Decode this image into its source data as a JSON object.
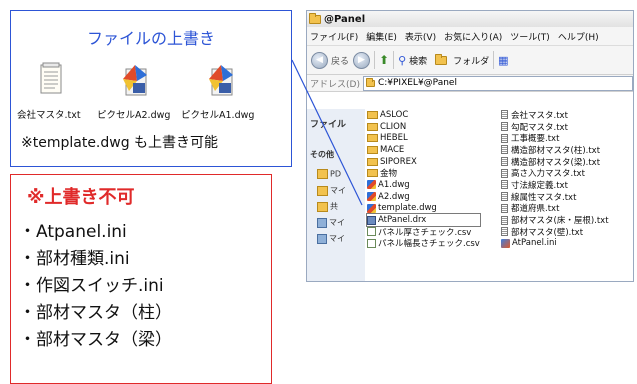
{
  "callout": {
    "title": "ファイルの上書き",
    "files": [
      {
        "label": "会社マスタ.txt",
        "icon": "text-file-icon"
      },
      {
        "label": "ピクセルA2.dwg",
        "icon": "dwg-file-icon"
      },
      {
        "label": "ピクセルA1.dwg",
        "icon": "dwg-file-icon"
      }
    ],
    "note": "※template.dwg も上書き可能"
  },
  "warning": {
    "title": "※上書き不可",
    "items": [
      "・Atpanel.ini",
      "・部材種類.ini",
      "・作図スイッチ.ini",
      "・部材マスタ（柱）",
      "・部材マスタ（梁）"
    ]
  },
  "explorer": {
    "title": "@Panel",
    "menu": [
      "ファイル(F)",
      "編集(E)",
      "表示(V)",
      "お気に入り(A)",
      "ツール(T)",
      "ヘルプ(H)"
    ],
    "toolbar": {
      "back": "戻る",
      "search": "検索",
      "folders": "フォルダ"
    },
    "address_label": "アドレス(D)",
    "address": "C:¥PIXEL¥@Panel",
    "left_pane": {
      "tab1": "ファイル",
      "tab2": "その他",
      "items": [
        "PD",
        "マイ",
        "共",
        "マイ",
        "マイ"
      ]
    },
    "column_a": [
      {
        "name": "ASLOC",
        "type": "folder"
      },
      {
        "name": "CLION",
        "type": "folder"
      },
      {
        "name": "HEBEL",
        "type": "folder"
      },
      {
        "name": "MACE",
        "type": "folder"
      },
      {
        "name": "SIPOREX",
        "type": "folder"
      },
      {
        "name": "金物",
        "type": "folder"
      },
      {
        "name": "A1.dwg",
        "type": "dwg"
      },
      {
        "name": "A2.dwg",
        "type": "dwg"
      },
      {
        "name": "template.dwg",
        "type": "dwg"
      },
      {
        "name": "AtPanel.drx",
        "type": "drx"
      },
      {
        "name": "パネル厚さチェック.csv",
        "type": "csv"
      },
      {
        "name": "パネル幅長さチェック.csv",
        "type": "csv"
      }
    ],
    "column_b": [
      {
        "name": "会社マスタ.txt",
        "type": "txt"
      },
      {
        "name": "勾配マスタ.txt",
        "type": "txt"
      },
      {
        "name": "工事概要.txt",
        "type": "txt"
      },
      {
        "name": "構造部材マスタ(柱).txt",
        "type": "txt"
      },
      {
        "name": "構造部材マスタ(梁).txt",
        "type": "txt"
      },
      {
        "name": "高さ入力マスタ.txt",
        "type": "txt"
      },
      {
        "name": "寸法線定義.txt",
        "type": "txt"
      },
      {
        "name": "線属性マスタ.txt",
        "type": "txt"
      },
      {
        "name": "都道府県.txt",
        "type": "txt"
      },
      {
        "name": "部材マスタ(床・屋根).txt",
        "type": "txt"
      },
      {
        "name": "部材マスタ(壁).txt",
        "type": "txt"
      },
      {
        "name": "AtPanel.ini",
        "type": "ini"
      }
    ],
    "colors": {
      "accent_blue": "#2d55d6",
      "warning_red": "#e02a2a"
    }
  }
}
